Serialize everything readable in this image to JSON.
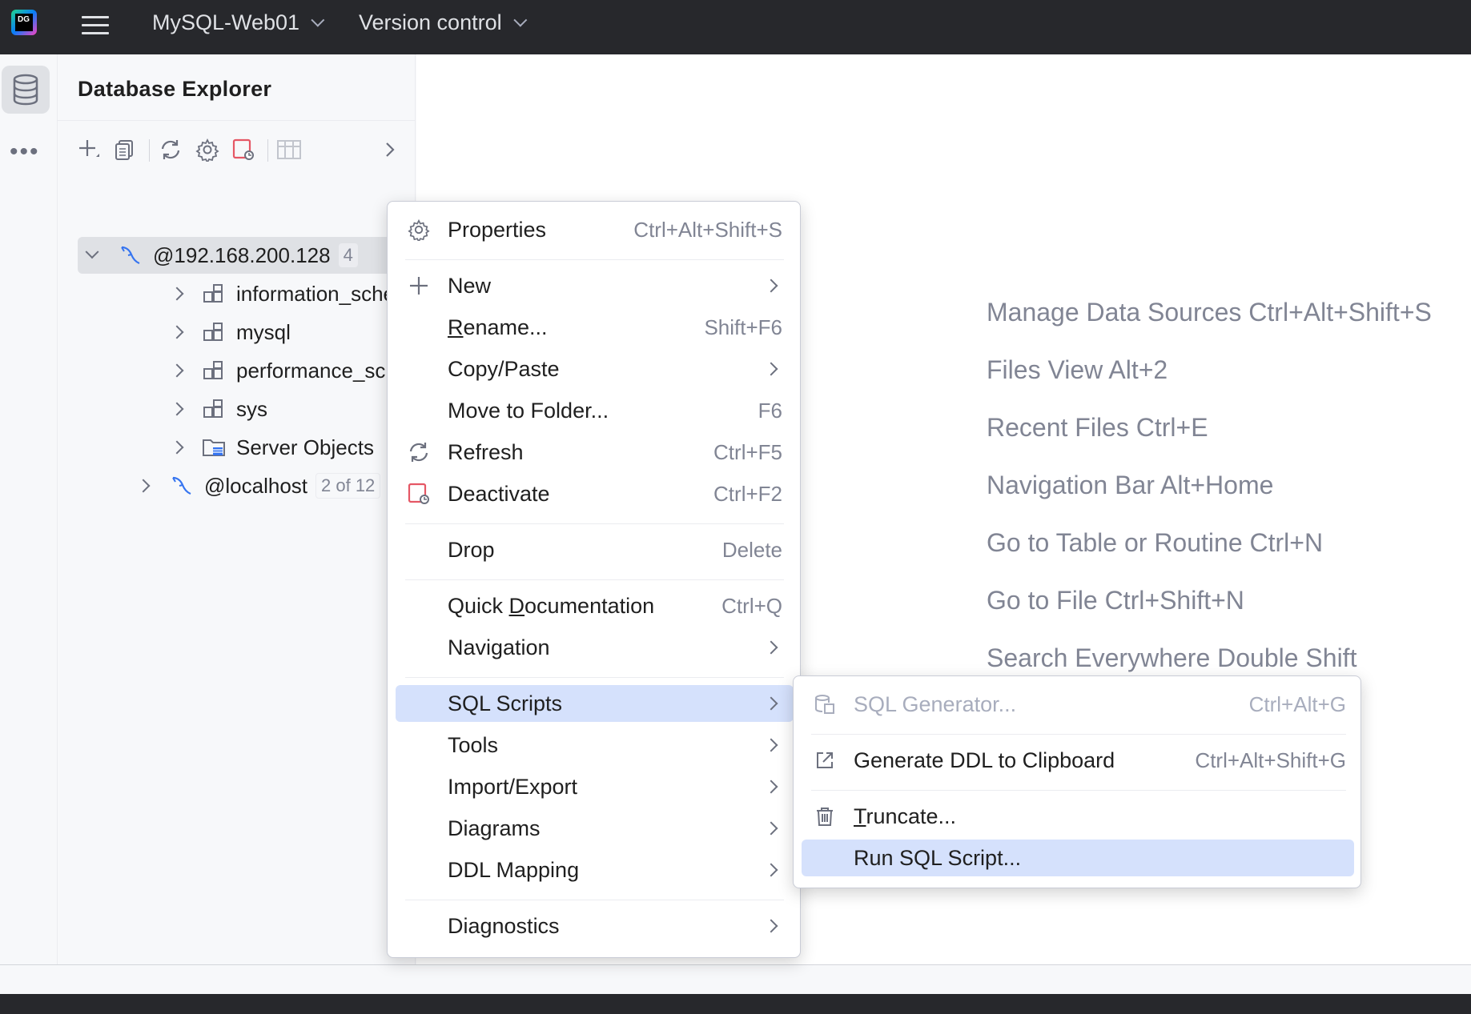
{
  "titlebar": {
    "project": "MySQL-Web01",
    "vcs": "Version control"
  },
  "explorer": {
    "title": "Database Explorer",
    "tree": [
      {
        "label": "@192.168.200.128",
        "badge": "4",
        "expanded": true
      },
      {
        "label": "information_schema"
      },
      {
        "label": "mysql"
      },
      {
        "label": "performance_schema"
      },
      {
        "label": "sys"
      },
      {
        "label": "Server Objects"
      },
      {
        "label": "@localhost",
        "badge": "2 of 12",
        "expanded": false
      }
    ]
  },
  "hints": [
    "Manage Data Sources Ctrl+Alt+Shift+S",
    "Files View Alt+2",
    "Recent Files Ctrl+E",
    "Navigation Bar Alt+Home",
    "Go to Table or Routine Ctrl+N",
    "Go to File Ctrl+Shift+N",
    "Search Everywhere Double Shift"
  ],
  "context_menu": {
    "items": [
      {
        "label": "Properties",
        "shortcut": "Ctrl+Alt+Shift+S",
        "icon": "gear-icon"
      },
      {
        "label": "New",
        "submenu": true,
        "icon": "plus-icon"
      },
      {
        "label": "Rename...",
        "mnemonic": "R",
        "rest": "ename...",
        "shortcut": "Shift+F6"
      },
      {
        "label": "Copy/Paste",
        "submenu": true
      },
      {
        "label": "Move to Folder...",
        "shortcut": "F6"
      },
      {
        "label": "Refresh",
        "shortcut": "Ctrl+F5",
        "icon": "refresh-icon"
      },
      {
        "label": "Deactivate",
        "shortcut": "Ctrl+F2",
        "icon": "deactivate-icon"
      },
      {
        "label": "Drop",
        "shortcut": "Delete"
      },
      {
        "label": "Quick Documentation",
        "pre": "Quick ",
        "mnemonic": "D",
        "rest": "ocumentation",
        "shortcut": "Ctrl+Q"
      },
      {
        "label": "Navigation",
        "submenu": true
      },
      {
        "label": "SQL Scripts",
        "submenu": true,
        "active": true
      },
      {
        "label": "Tools",
        "submenu": true
      },
      {
        "label": "Import/Export",
        "submenu": true
      },
      {
        "label": "Diagrams",
        "submenu": true
      },
      {
        "label": "DDL Mapping",
        "submenu": true
      },
      {
        "label": "Diagnostics",
        "submenu": true
      }
    ]
  },
  "submenu": {
    "items": [
      {
        "label": "SQL Generator...",
        "shortcut": "Ctrl+Alt+G",
        "disabled": true,
        "icon": "sql-generator-icon"
      },
      {
        "label": "Generate DDL to Clipboard",
        "shortcut": "Ctrl+Alt+Shift+G",
        "icon": "export-arrow-icon"
      },
      {
        "label": "Truncate...",
        "mnemonic": "T",
        "rest": "runcate...",
        "icon": "trash-icon"
      },
      {
        "label": "Run SQL Script...",
        "active": true
      }
    ]
  }
}
